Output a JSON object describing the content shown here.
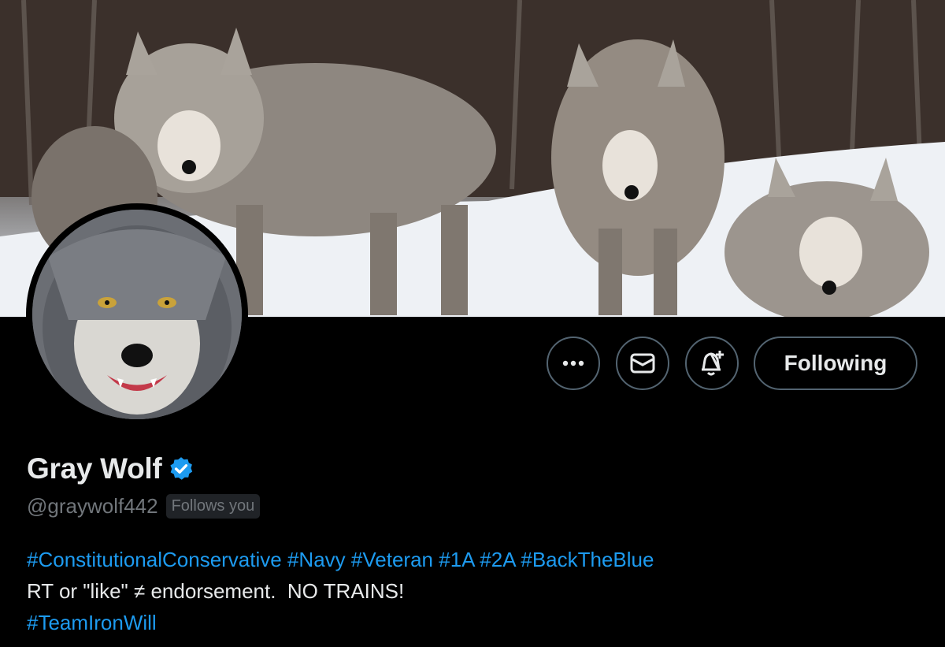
{
  "profile": {
    "display_name": "Gray Wolf",
    "handle": "@graywolf442",
    "follows_you_badge": "Follows you",
    "verified": true
  },
  "actions": {
    "more_label": "More",
    "message_label": "Message",
    "notify_label": "Turn on notifications",
    "following_label": "Following"
  },
  "bio": {
    "line1_tags": [
      "#ConstitutionalConservative",
      "#Navy",
      "#Veteran",
      "#1A",
      "#2A",
      "#BackTheBlue"
    ],
    "line2": "RT or \"like\" ≠ endorsement.  NO TRAINS!",
    "line3_tag": "#TeamIronWill"
  },
  "icons": {
    "more": "more-icon",
    "message": "envelope-icon",
    "notify": "bell-plus-icon",
    "verified": "verified-badge-icon"
  },
  "colors": {
    "background": "#000000",
    "text": "#e7e9ea",
    "secondary": "#71767b",
    "link": "#1d9bf0",
    "border": "#536471"
  }
}
